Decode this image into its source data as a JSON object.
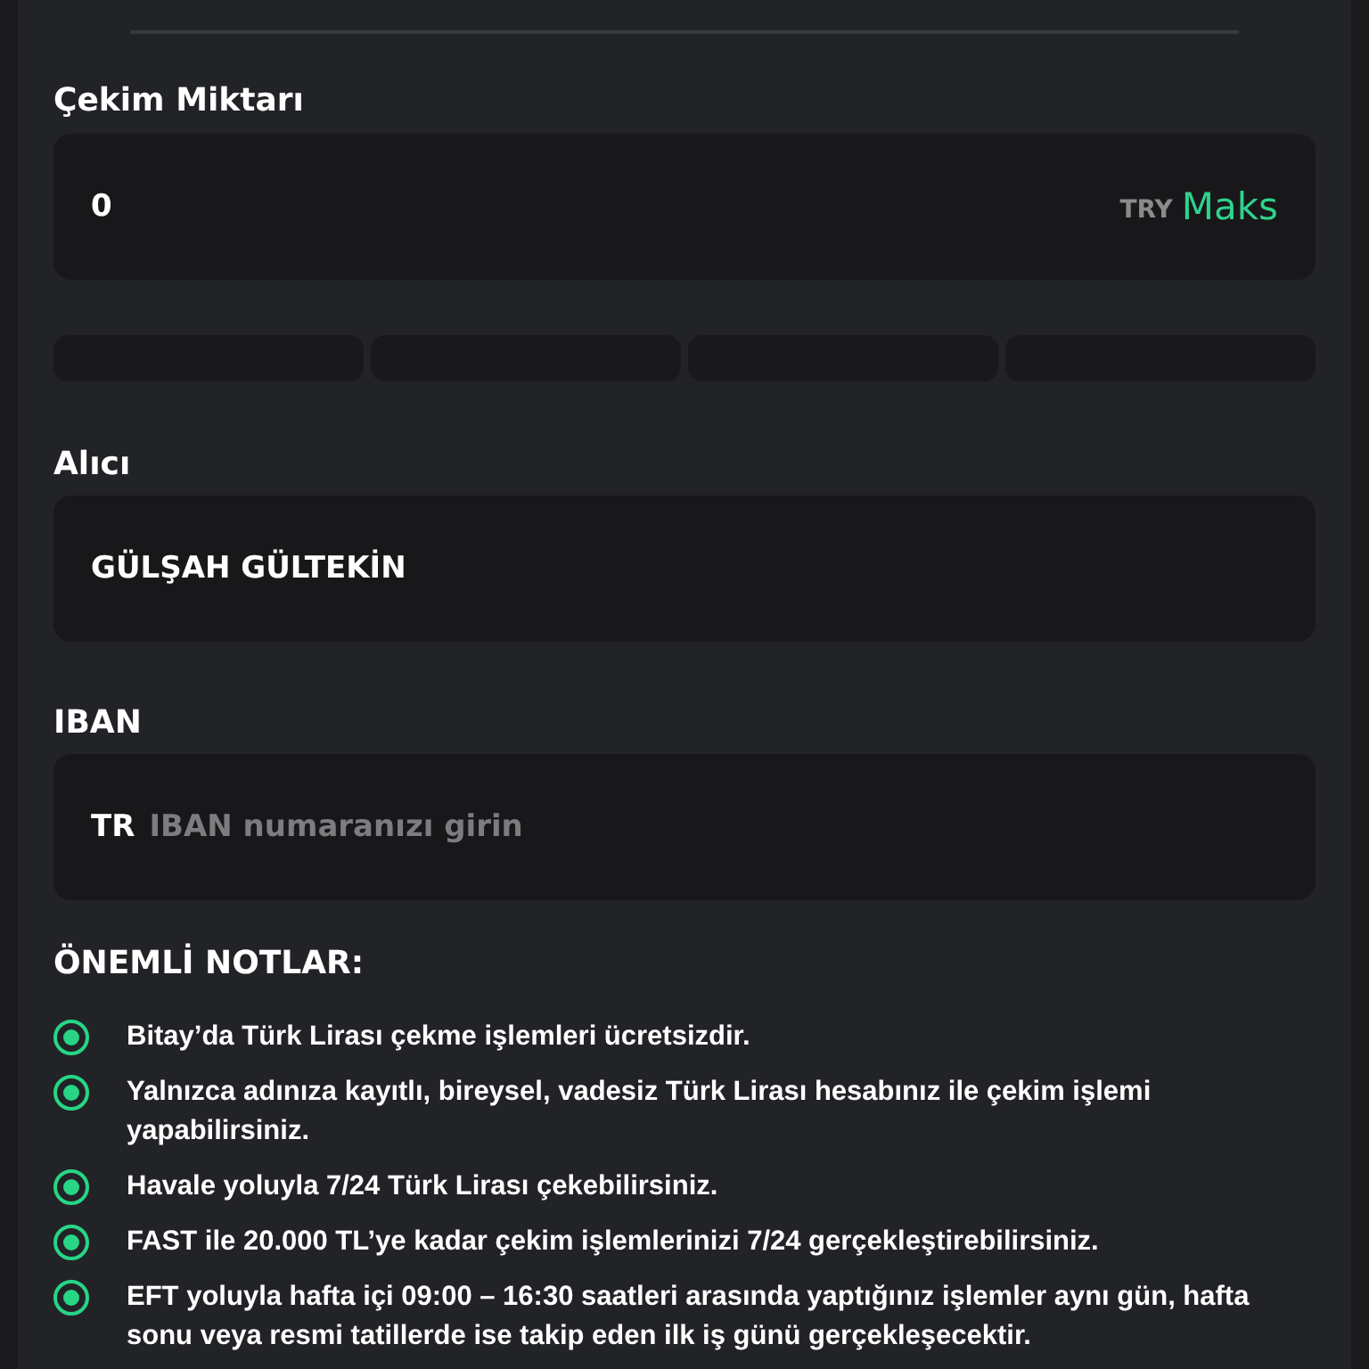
{
  "amount": {
    "label": "Çekim Miktarı",
    "value": "0",
    "currency": "TRY",
    "max_button": "Maks",
    "presets": [
      {
        "selected": false
      },
      {
        "selected": false
      },
      {
        "selected": false
      },
      {
        "selected": false
      }
    ]
  },
  "recipient": {
    "label": "Alıcı",
    "value": "GÜLŞAH GÜLTEKİN"
  },
  "iban": {
    "label": "IBAN",
    "prefix": "TR",
    "placeholder": "IBAN numaranızı girin"
  },
  "notes": {
    "title": "ÖNEMLİ NOTLAR:",
    "items": [
      "Bitay’da Türk Lirası çekme işlemleri ücretsizdir.",
      "Yalnızca adınıza kayıtlı, bireysel, vadesiz Türk Lirası hesabınız ile çekim işlemi yapabilirsiniz.",
      "Havale yoluyla 7/24 Türk Lirası çekebilirsiniz.",
      "FAST ile 20.000 TL’ye kadar çekim işlemlerinizi 7/24 gerçekleştirebilirsiniz.",
      "EFT yoluyla hafta içi 09:00 – 16:30 saatleri arasında yaptığınız işlemler aynı gün, hafta sonu veya resmi tatillerde ise takip eden ilk iş günü gerçekleşecektir."
    ]
  }
}
